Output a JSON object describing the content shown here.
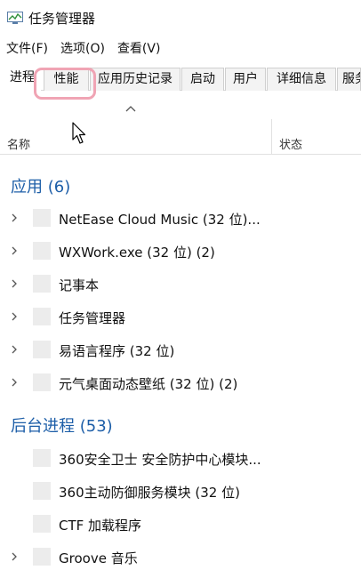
{
  "window": {
    "title": "任务管理器",
    "icon": "task-manager-icon"
  },
  "menu": {
    "items": [
      "文件(F)",
      "选项(O)",
      "查看(V)"
    ]
  },
  "tabs": [
    {
      "label": "进程",
      "active": true
    },
    {
      "label": "性能",
      "active": false
    },
    {
      "label": "应用历史记录",
      "active": false
    },
    {
      "label": "启动",
      "active": false
    },
    {
      "label": "用户",
      "active": false
    },
    {
      "label": "详细信息",
      "active": false
    },
    {
      "label": "服务",
      "active": false
    }
  ],
  "columns": {
    "name": "名称",
    "status": "状态"
  },
  "groups": {
    "apps": {
      "title": "应用 (6)",
      "items": [
        {
          "name": "NetEase Cloud Music (32 位)...",
          "expandable": true
        },
        {
          "name": "WXWork.exe (32 位) (2)",
          "expandable": true
        },
        {
          "name": "记事本",
          "expandable": true
        },
        {
          "name": "任务管理器",
          "expandable": true
        },
        {
          "name": "易语言程序 (32 位)",
          "expandable": true
        },
        {
          "name": "元气桌面动态壁纸 (32 位) (2)",
          "expandable": true
        }
      ]
    },
    "background": {
      "title": "后台进程 (53)",
      "items": [
        {
          "name": "360安全卫士 安全防护中心模块...",
          "expandable": false
        },
        {
          "name": "360主动防御服务模块 (32 位)",
          "expandable": false
        },
        {
          "name": "CTF 加载程序",
          "expandable": false
        },
        {
          "name": "Groove 音乐",
          "expandable": true
        }
      ]
    }
  },
  "accent": "#1d5ea8",
  "highlight": "#f0a4b4"
}
